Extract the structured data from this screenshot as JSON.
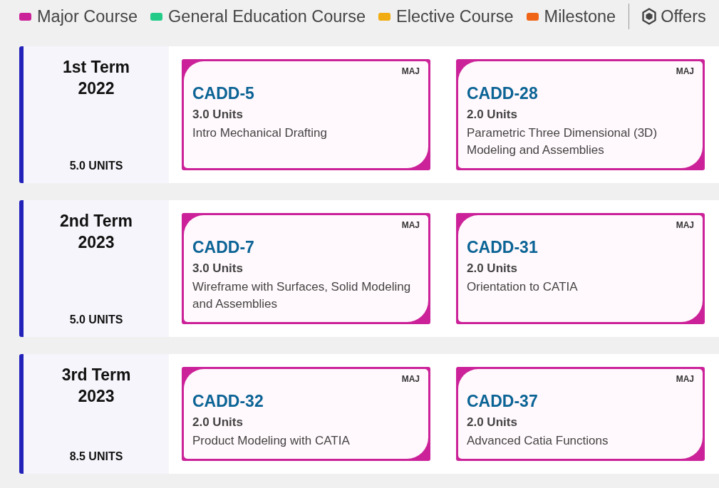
{
  "legend": {
    "items": [
      {
        "label": "Major Course",
        "color": "#cc2299"
      },
      {
        "label": "General Education Course",
        "color": "#22cc88"
      },
      {
        "label": "Elective Course",
        "color": "#f0ac10"
      },
      {
        "label": "Milestone",
        "color": "#f06418"
      }
    ],
    "offers": {
      "label": "Offers"
    }
  },
  "terms": [
    {
      "term": "1st Term",
      "year": "2022",
      "units": "5.0 UNITS",
      "courses": [
        {
          "tag": "MAJ",
          "code": "CADD-5",
          "units": "3.0 Units",
          "name": "Intro Mechanical Drafting",
          "color": "#cc2299"
        },
        {
          "tag": "MAJ",
          "code": "CADD-28",
          "units": "2.0 Units",
          "name": "Parametric Three Dimensional (3D) Modeling and Assemblies",
          "color": "#cc2299"
        }
      ]
    },
    {
      "term": "2nd Term",
      "year": "2023",
      "units": "5.0 UNITS",
      "courses": [
        {
          "tag": "MAJ",
          "code": "CADD-7",
          "units": "3.0 Units",
          "name": "Wireframe with Surfaces, Solid Modeling and Assemblies",
          "color": "#cc2299"
        },
        {
          "tag": "MAJ",
          "code": "CADD-31",
          "units": "2.0 Units",
          "name": "Orientation to CATIA",
          "color": "#cc2299"
        }
      ]
    },
    {
      "term": "3rd Term",
      "year": "2023",
      "units": "8.5 UNITS",
      "courses": [
        {
          "tag": "MAJ",
          "code": "CADD-32",
          "units": "2.0 Units",
          "name": "Product Modeling with CATIA",
          "color": "#cc2299"
        },
        {
          "tag": "MAJ",
          "code": "CADD-37",
          "units": "2.0 Units",
          "name": "Advanced Catia Functions",
          "color": "#cc2299"
        }
      ]
    }
  ]
}
